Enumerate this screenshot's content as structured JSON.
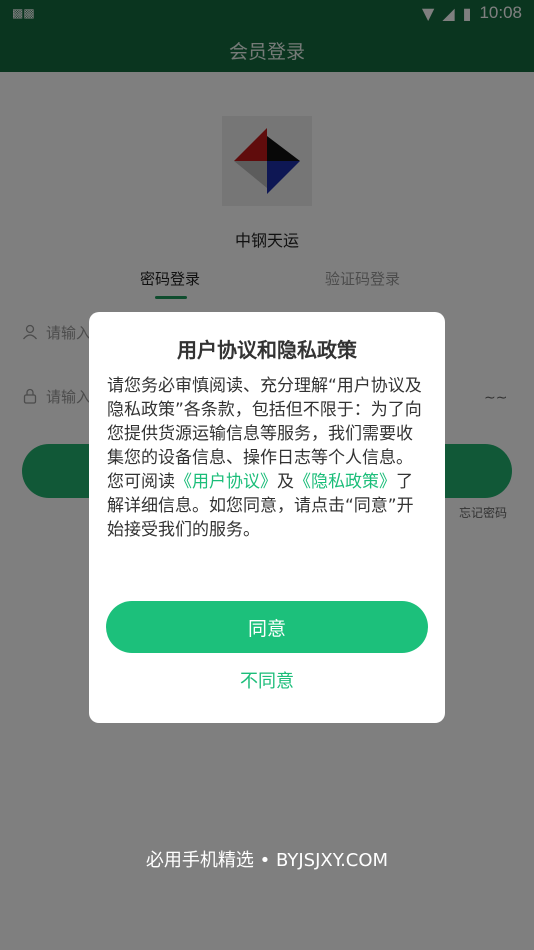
{
  "status_bar": {
    "time": "10:08",
    "left_icon": "notification-icon",
    "icons": [
      "wifi-icon",
      "signal-icon",
      "battery-icon"
    ]
  },
  "header": {
    "title": "会员登录"
  },
  "app": {
    "name": "中钢天运"
  },
  "tabs": [
    {
      "label": "密码登录"
    },
    {
      "label": "验证码登录"
    }
  ],
  "form": {
    "username_placeholder": "请输入",
    "password_placeholder": "请输入",
    "forgot_label": "忘记密码"
  },
  "dialog": {
    "title": "用户协议和隐私政策",
    "body_1": "请您务必审慎阅读、充分理解“用户协议及隐私政策”各条款，包括但不限于：为了向您提供货源运输信息等服务，我们需要收集您的设备信息、操作日志等个人信息。",
    "body_2_prefix": "您可阅读",
    "link_user_agreement": "《用户协议》",
    "body_2_and": "及",
    "link_privacy_policy": "《隐私政策》",
    "body_2_suffix": "了解详细信息。如您同意，请点击“同意”开始接受我们的服务。",
    "agree_label": "同意",
    "disagree_label": "不同意"
  },
  "watermark": "必用手机精选 • BYJSJXY.COM",
  "colors": {
    "brand_dark": "#146b3f",
    "accent": "#1cc07b",
    "link": "#1bbd79"
  }
}
